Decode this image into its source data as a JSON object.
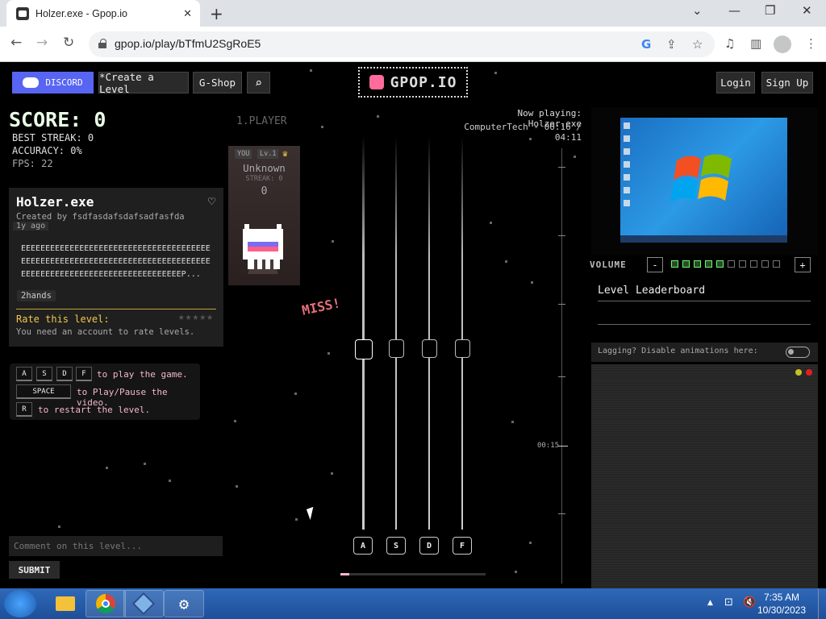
{
  "browser": {
    "tab_title": "Holzer.exe - Gpop.io",
    "url": "gpop.io/play/bTfmU2SgRoE5",
    "window_controls": [
      "⌄",
      "—",
      "❐",
      "✕"
    ]
  },
  "nav": {
    "discord_label": "DISCORD",
    "create_label": "*Create a Level",
    "gshop_label": "G-Shop",
    "logo_text": "GPOP.IO",
    "login_label": "Login",
    "signup_label": "Sign Up"
  },
  "stats": {
    "score": "SCORE: 0",
    "best_streak": "BEST STREAK: 0",
    "accuracy": "ACCURACY: 0%",
    "fps": "FPS: 22"
  },
  "level": {
    "title": "Holzer.exe",
    "creator": "Created by fsdfasdafsdafsadfasfda",
    "ago": "1y ago",
    "description": "EEEEEEEEEEEEEEEEEEEEEEEEEEEEEEEEEEEEEEEEEEEEEEEEEEEEEEEEEEEEEEEEEEEEEEEEEEEEEEEEEEEEEEEEEEEEEEEEEEEEEEEEEEEEEEEP...",
    "tag": "2hands",
    "rate_label": "Rate this level:",
    "rate_note": "You need an account to rate levels.",
    "rating_stars": "★★★★★"
  },
  "help": {
    "keys": [
      "A",
      "S",
      "D",
      "F"
    ],
    "play_text": "to play the game.",
    "space_key": "SPACE",
    "pause_text": "to Play/Pause the video.",
    "restart_key": "R",
    "restart_text": "to restart the level."
  },
  "comment": {
    "placeholder": "Comment on this level...",
    "submit_label": "SUBMIT"
  },
  "player": {
    "header": "1.PLAYER",
    "badge_you": "YOU",
    "badge_level": "Lv.1",
    "name": "Unknown",
    "streak": "STREAK: 0",
    "score": "0"
  },
  "game": {
    "miss_text": "MISS!",
    "now_playing": "Now playing: Holzer.exe",
    "track_time": "ComputerTech - 00:16 / 04:11",
    "lane_keys": [
      "A",
      "S",
      "D",
      "F"
    ],
    "timeline_time": "00:15",
    "progress_percent": 6
  },
  "sidebar": {
    "volume_label": "VOLUME",
    "volume_minus": "-",
    "volume_plus": "+",
    "volume_level": 5,
    "volume_segments": 10,
    "leaderboard_title": "Level Leaderboard",
    "lag_text": "Lagging? Disable animations here:"
  },
  "taskbar": {
    "time": "7:35 AM",
    "date": "10/30/2023"
  },
  "colors": {
    "accent_pink": "#f4b8cc",
    "discord": "#5865f2",
    "rate_yellow": "#f1c84b",
    "miss_red": "#e66f79"
  }
}
